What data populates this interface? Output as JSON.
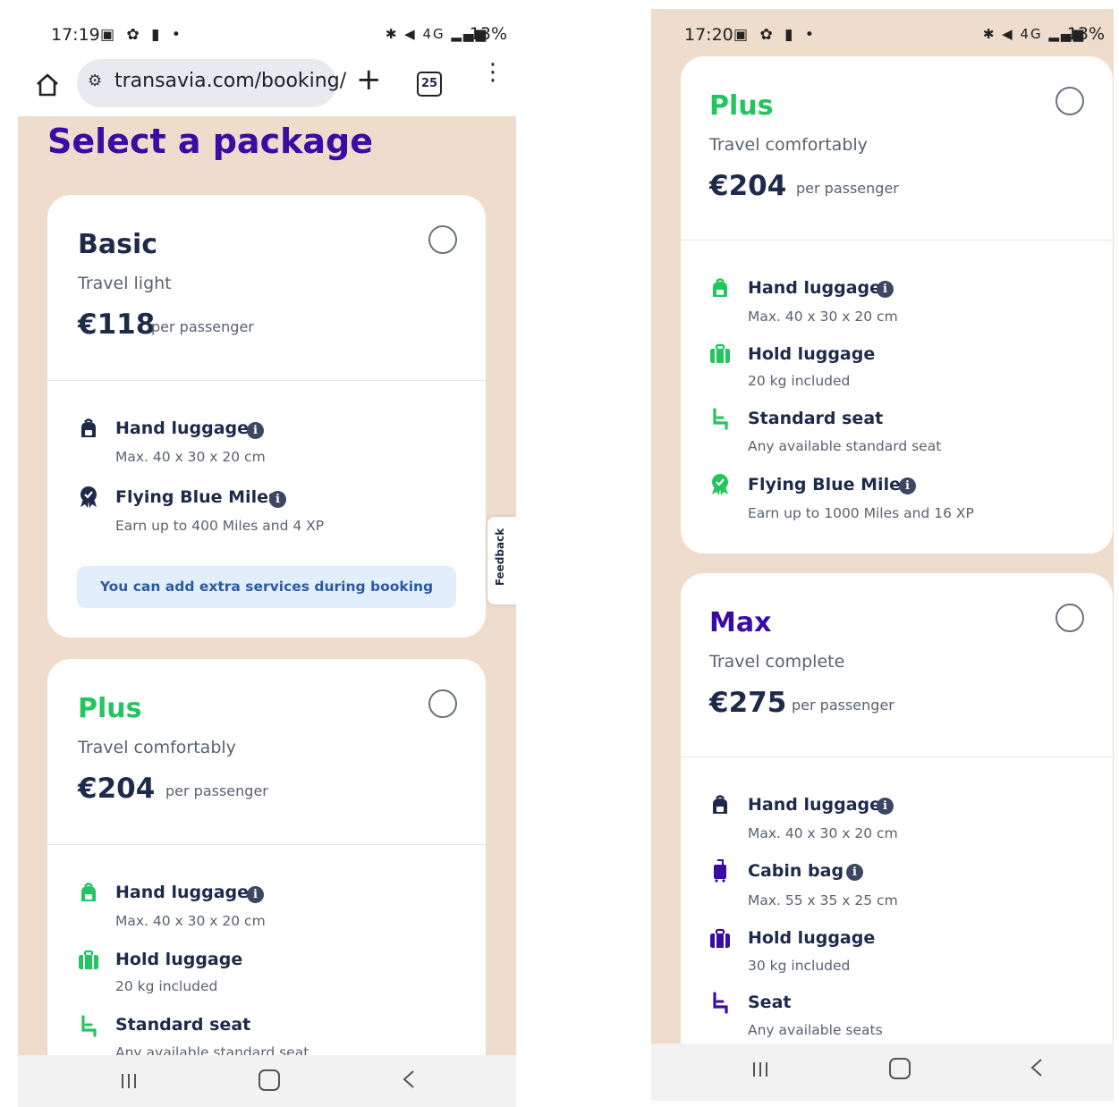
{
  "left": {
    "status": {
      "time": "17:19",
      "battery": "13%"
    },
    "browser": {
      "url": "transavia.com/booking/",
      "tab_count": "25"
    },
    "title": "Select a package",
    "feedback": "Feedback",
    "packages": {
      "basic": {
        "name": "Basic",
        "tagline": "Travel light",
        "price": "€118",
        "per": "per passenger",
        "features": [
          {
            "title": "Hand luggage",
            "sub": "Max. 40 x 30 x 20 cm",
            "icon": "backpack-icon"
          },
          {
            "title": "Flying Blue Miles",
            "sub": "Earn up to 400 Miles and 4 XP",
            "icon": "badge-icon"
          }
        ],
        "note": "You can add extra services during booking"
      },
      "plus": {
        "name": "Plus",
        "tagline": "Travel comfortably",
        "price": "€204",
        "per": "per passenger",
        "features": [
          {
            "title": "Hand luggage",
            "sub": "Max. 40 x 30 x 20 cm",
            "icon": "backpack-icon"
          },
          {
            "title": "Hold luggage",
            "sub": "20 kg included",
            "icon": "suitcase-icon"
          },
          {
            "title": "Standard seat",
            "sub": "Any available standard seat",
            "icon": "seat-icon"
          }
        ]
      }
    }
  },
  "right": {
    "status": {
      "time": "17:20",
      "battery": "13%"
    },
    "packages": {
      "plus": {
        "name": "Plus",
        "tagline": "Travel comfortably",
        "price": "€204",
        "per": "per passenger",
        "features": [
          {
            "title": "Hand luggage",
            "sub": "Max. 40 x 30 x 20 cm",
            "icon": "backpack-icon"
          },
          {
            "title": "Hold luggage",
            "sub": "20 kg included",
            "icon": "suitcase-icon"
          },
          {
            "title": "Standard seat",
            "sub": "Any available standard seat",
            "icon": "seat-icon"
          },
          {
            "title": "Flying Blue Miles",
            "sub": "Earn up to 1000 Miles and 16 XP",
            "icon": "badge-icon"
          }
        ]
      },
      "max": {
        "name": "Max",
        "tagline": "Travel complete",
        "price": "€275",
        "per": "per passenger",
        "features": [
          {
            "title": "Hand luggage",
            "sub": "Max. 40 x 30 x 20 cm",
            "icon": "backpack-icon"
          },
          {
            "title": "Cabin bag",
            "sub": "Max. 55 x 35 x 25 cm",
            "icon": "trolley-icon"
          },
          {
            "title": "Hold luggage",
            "sub": "30 kg included",
            "icon": "suitcase-icon"
          },
          {
            "title": "Seat",
            "sub": "Any available seats",
            "icon": "seat-icon"
          }
        ]
      }
    }
  },
  "colors": {
    "page_bg": "#eedccc",
    "title": "#3a0ca3",
    "plus": "#22c55e",
    "text": "#1e2a4a",
    "note_bg": "#e3eefc"
  }
}
